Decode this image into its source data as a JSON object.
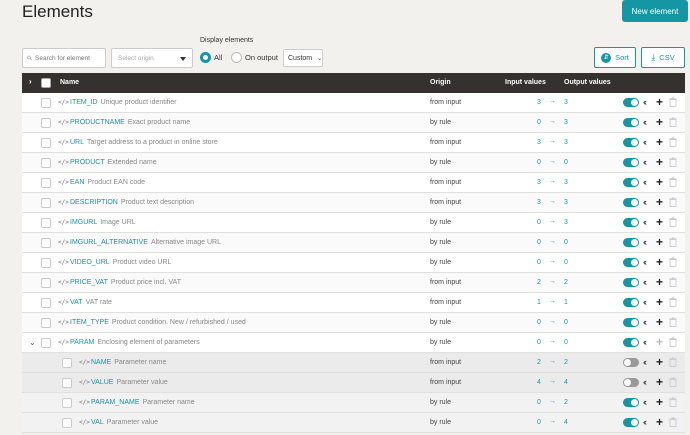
{
  "page": {
    "title": "Elements",
    "new_button": "New element"
  },
  "filters": {
    "search_placeholder": "Search for element",
    "origin_placeholder": "Select origin",
    "display_label": "Display elements",
    "radio_all": "All",
    "radio_on_output": "On output",
    "custom": "Custom",
    "sort": "Sort",
    "csv": "CSV"
  },
  "table": {
    "headers": {
      "name": "Name",
      "origin": "Origin",
      "input": "Input values",
      "output": "Output values"
    },
    "rows": [
      {
        "name": "ITEM_ID",
        "desc": "Unique product identifier",
        "origin": "from input",
        "in": "3",
        "out": "3",
        "on": true
      },
      {
        "name": "PRODUCTNAME",
        "desc": "Exact product name",
        "origin": "by rule",
        "in": "0",
        "out": "3",
        "on": true
      },
      {
        "name": "URL",
        "desc": "Target address to a product in online store",
        "origin": "from input",
        "in": "3",
        "out": "3",
        "on": true
      },
      {
        "name": "PRODUCT",
        "desc": "Extended name",
        "origin": "by rule",
        "in": "0",
        "out": "0",
        "on": true
      },
      {
        "name": "EAN",
        "desc": "Product EAN code",
        "origin": "from input",
        "in": "3",
        "out": "3",
        "on": true
      },
      {
        "name": "DESCRIPTION",
        "desc": "Product text description",
        "origin": "from input",
        "in": "3",
        "out": "3",
        "on": true
      },
      {
        "name": "IMGURL",
        "desc": "Image URL",
        "origin": "by rule",
        "in": "0",
        "out": "3",
        "on": true
      },
      {
        "name": "IMGURL_ALTERNATIVE",
        "desc": "Alternative image URL",
        "origin": "by rule",
        "in": "0",
        "out": "0",
        "on": true
      },
      {
        "name": "VIDEO_URL",
        "desc": "Product video URL",
        "origin": "by rule",
        "in": "0",
        "out": "0",
        "on": true
      },
      {
        "name": "PRICE_VAT",
        "desc": "Product price incl. VAT",
        "origin": "from input",
        "in": "2",
        "out": "2",
        "on": true
      },
      {
        "name": "VAT",
        "desc": "VAT rate",
        "origin": "from input",
        "in": "1",
        "out": "1",
        "on": true
      },
      {
        "name": "ITEM_TYPE",
        "desc": "Product condition. New / refurbished / used",
        "origin": "by rule",
        "in": "0",
        "out": "0",
        "on": true
      },
      {
        "name": "PARAM",
        "desc": "Enclosing element of parameters",
        "origin": "by rule",
        "in": "0",
        "out": "0",
        "on": true
      },
      {
        "name": "NAME",
        "desc": "Parameter name",
        "origin": "from input",
        "in": "2",
        "out": "2",
        "on": false
      },
      {
        "name": "VALUE",
        "desc": "Parameter value",
        "origin": "from input",
        "in": "4",
        "out": "4",
        "on": false
      },
      {
        "name": "PARAM_NAME",
        "desc": "Parameter name",
        "origin": "by rule",
        "in": "0",
        "out": "2",
        "on": true
      },
      {
        "name": "VAL",
        "desc": "Parameter value",
        "origin": "by rule",
        "in": "0",
        "out": "4",
        "on": true
      }
    ]
  },
  "colors": {
    "accent": "#1596a4",
    "header_bg": "#34312f",
    "page_bg": "#f3f1ed"
  }
}
